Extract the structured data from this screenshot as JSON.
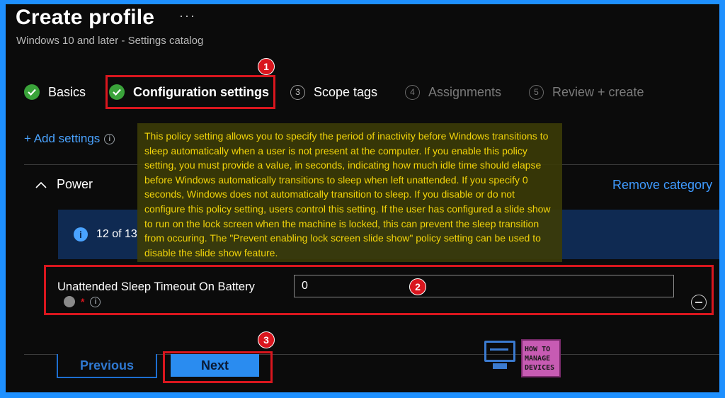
{
  "header": {
    "title": "Create profile",
    "more": "···",
    "subtitle": "Windows 10 and later - Settings catalog"
  },
  "steps": [
    {
      "label": "Basics",
      "state": "complete"
    },
    {
      "label": "Configuration settings",
      "state": "complete-current"
    },
    {
      "number": "3",
      "label": "Scope tags",
      "state": "active"
    },
    {
      "number": "4",
      "label": "Assignments",
      "state": "disabled"
    },
    {
      "number": "5",
      "label": "Review + create",
      "state": "disabled"
    }
  ],
  "annotations": {
    "badge1": "1",
    "badge2": "2",
    "badge3": "3"
  },
  "settings": {
    "add_label": "+ Add settings",
    "category": "Power",
    "remove_category": "Remove category",
    "info_text": "12 of 13"
  },
  "tooltip": {
    "text": "This policy setting allows you to specify the period of inactivity before Windows transitions to sleep automatically when a user is not present at the computer. If you enable this policy setting, you must provide a value, in seconds, indicating how much idle time should elapse before Windows automatically transitions to sleep when left unattended. If you specify 0 seconds, Windows does not automatically transition to sleep. If you disable or do not configure this policy setting, users control this setting. If the user has configured a slide show to run on the lock screen when the machine is locked, this can prevent the sleep transition from occuring. The \"Prevent enabling lock screen slide show\" policy setting can be used to disable the slide show feature."
  },
  "setting": {
    "label": "Unattended Sleep Timeout On Battery",
    "required": "*",
    "value": "0"
  },
  "footer": {
    "previous": "Previous",
    "next": "Next"
  },
  "logo": {
    "line1": "HOW TO",
    "line2": "MANAGE",
    "line3": "DEVICES"
  },
  "colors": {
    "accent": "#2a8cf0",
    "annotation_red": "#d9161e",
    "tooltip_text": "#f2d40a",
    "success": "#3aa33a"
  }
}
